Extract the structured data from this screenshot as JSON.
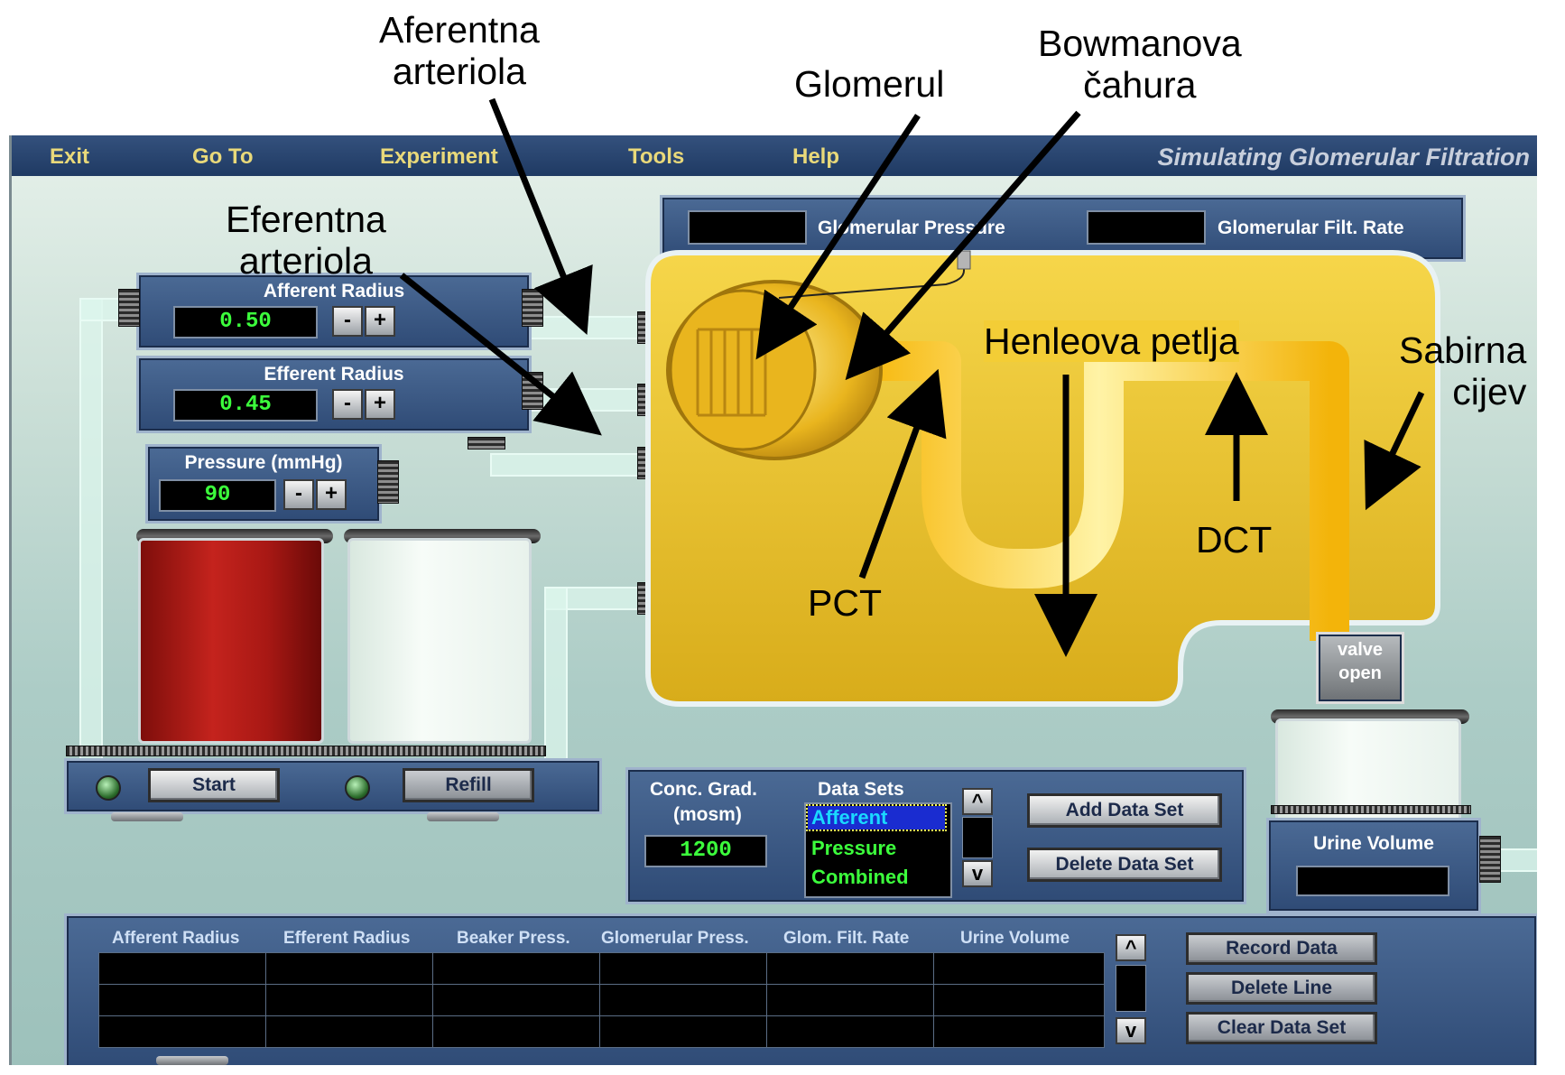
{
  "annotations": {
    "aferentna": "Aferentna\narteriola",
    "eferentna": "Eferentna\narteriola",
    "glomerul": "Glomerul",
    "bowmanova": "Bowmanova\nčahura",
    "henleova": "Henleova petlja",
    "sabirna": "Sabirna\ncijev",
    "pct": "PCT",
    "dct": "DCT"
  },
  "menubar": {
    "items": [
      "Exit",
      "Go To",
      "Experiment",
      "Tools",
      "Help"
    ],
    "title": "Simulating Glomerular Filtration"
  },
  "top_display": {
    "pressure_label": "Glomerular Pressure",
    "gfr_label": "Glomerular Filt. Rate",
    "pressure_value": "",
    "gfr_value": ""
  },
  "afferent": {
    "title": "Afferent Radius",
    "value": "0.50"
  },
  "efferent": {
    "title": "Efferent Radius",
    "value": "0.45"
  },
  "pressure": {
    "title": "Pressure (mmHg)",
    "value": "90"
  },
  "buttons": {
    "minus": "-",
    "plus": "+",
    "start": "Start",
    "refill": "Refill",
    "add_data_set": "Add Data Set",
    "delete_data_set": "Delete Data Set",
    "record_data": "Record Data",
    "delete_line": "Delete Line",
    "clear_data_set": "Clear Data Set",
    "scroll_up": "^",
    "scroll_down": "v"
  },
  "valve": {
    "line1": "valve",
    "line2": "open"
  },
  "conc_grad": {
    "title_line1": "Conc. Grad.",
    "title_line2": "(mosm)",
    "value": "1200"
  },
  "data_sets": {
    "title": "Data Sets",
    "items": [
      "Afferent",
      "Pressure",
      "Combined"
    ],
    "selected": "Afferent"
  },
  "urine": {
    "title": "Urine Volume",
    "value": ""
  },
  "table": {
    "headers": [
      "Afferent Radius",
      "Efferent Radius",
      "Beaker Press.",
      "Glomerular Press.",
      "Glom. Filt. Rate",
      "Urine Volume"
    ],
    "rows": [
      [
        "",
        "",
        "",
        "",
        "",
        ""
      ],
      [
        "",
        "",
        "",
        "",
        "",
        ""
      ],
      [
        "",
        "",
        "",
        "",
        "",
        ""
      ]
    ]
  },
  "colors": {
    "menubar": "#1f3a63",
    "menu_text": "#e9d97a",
    "panel": "#3c5985",
    "lcd_text": "#3cff3c",
    "nephron": "#f0c419",
    "blood": "#a81814"
  }
}
